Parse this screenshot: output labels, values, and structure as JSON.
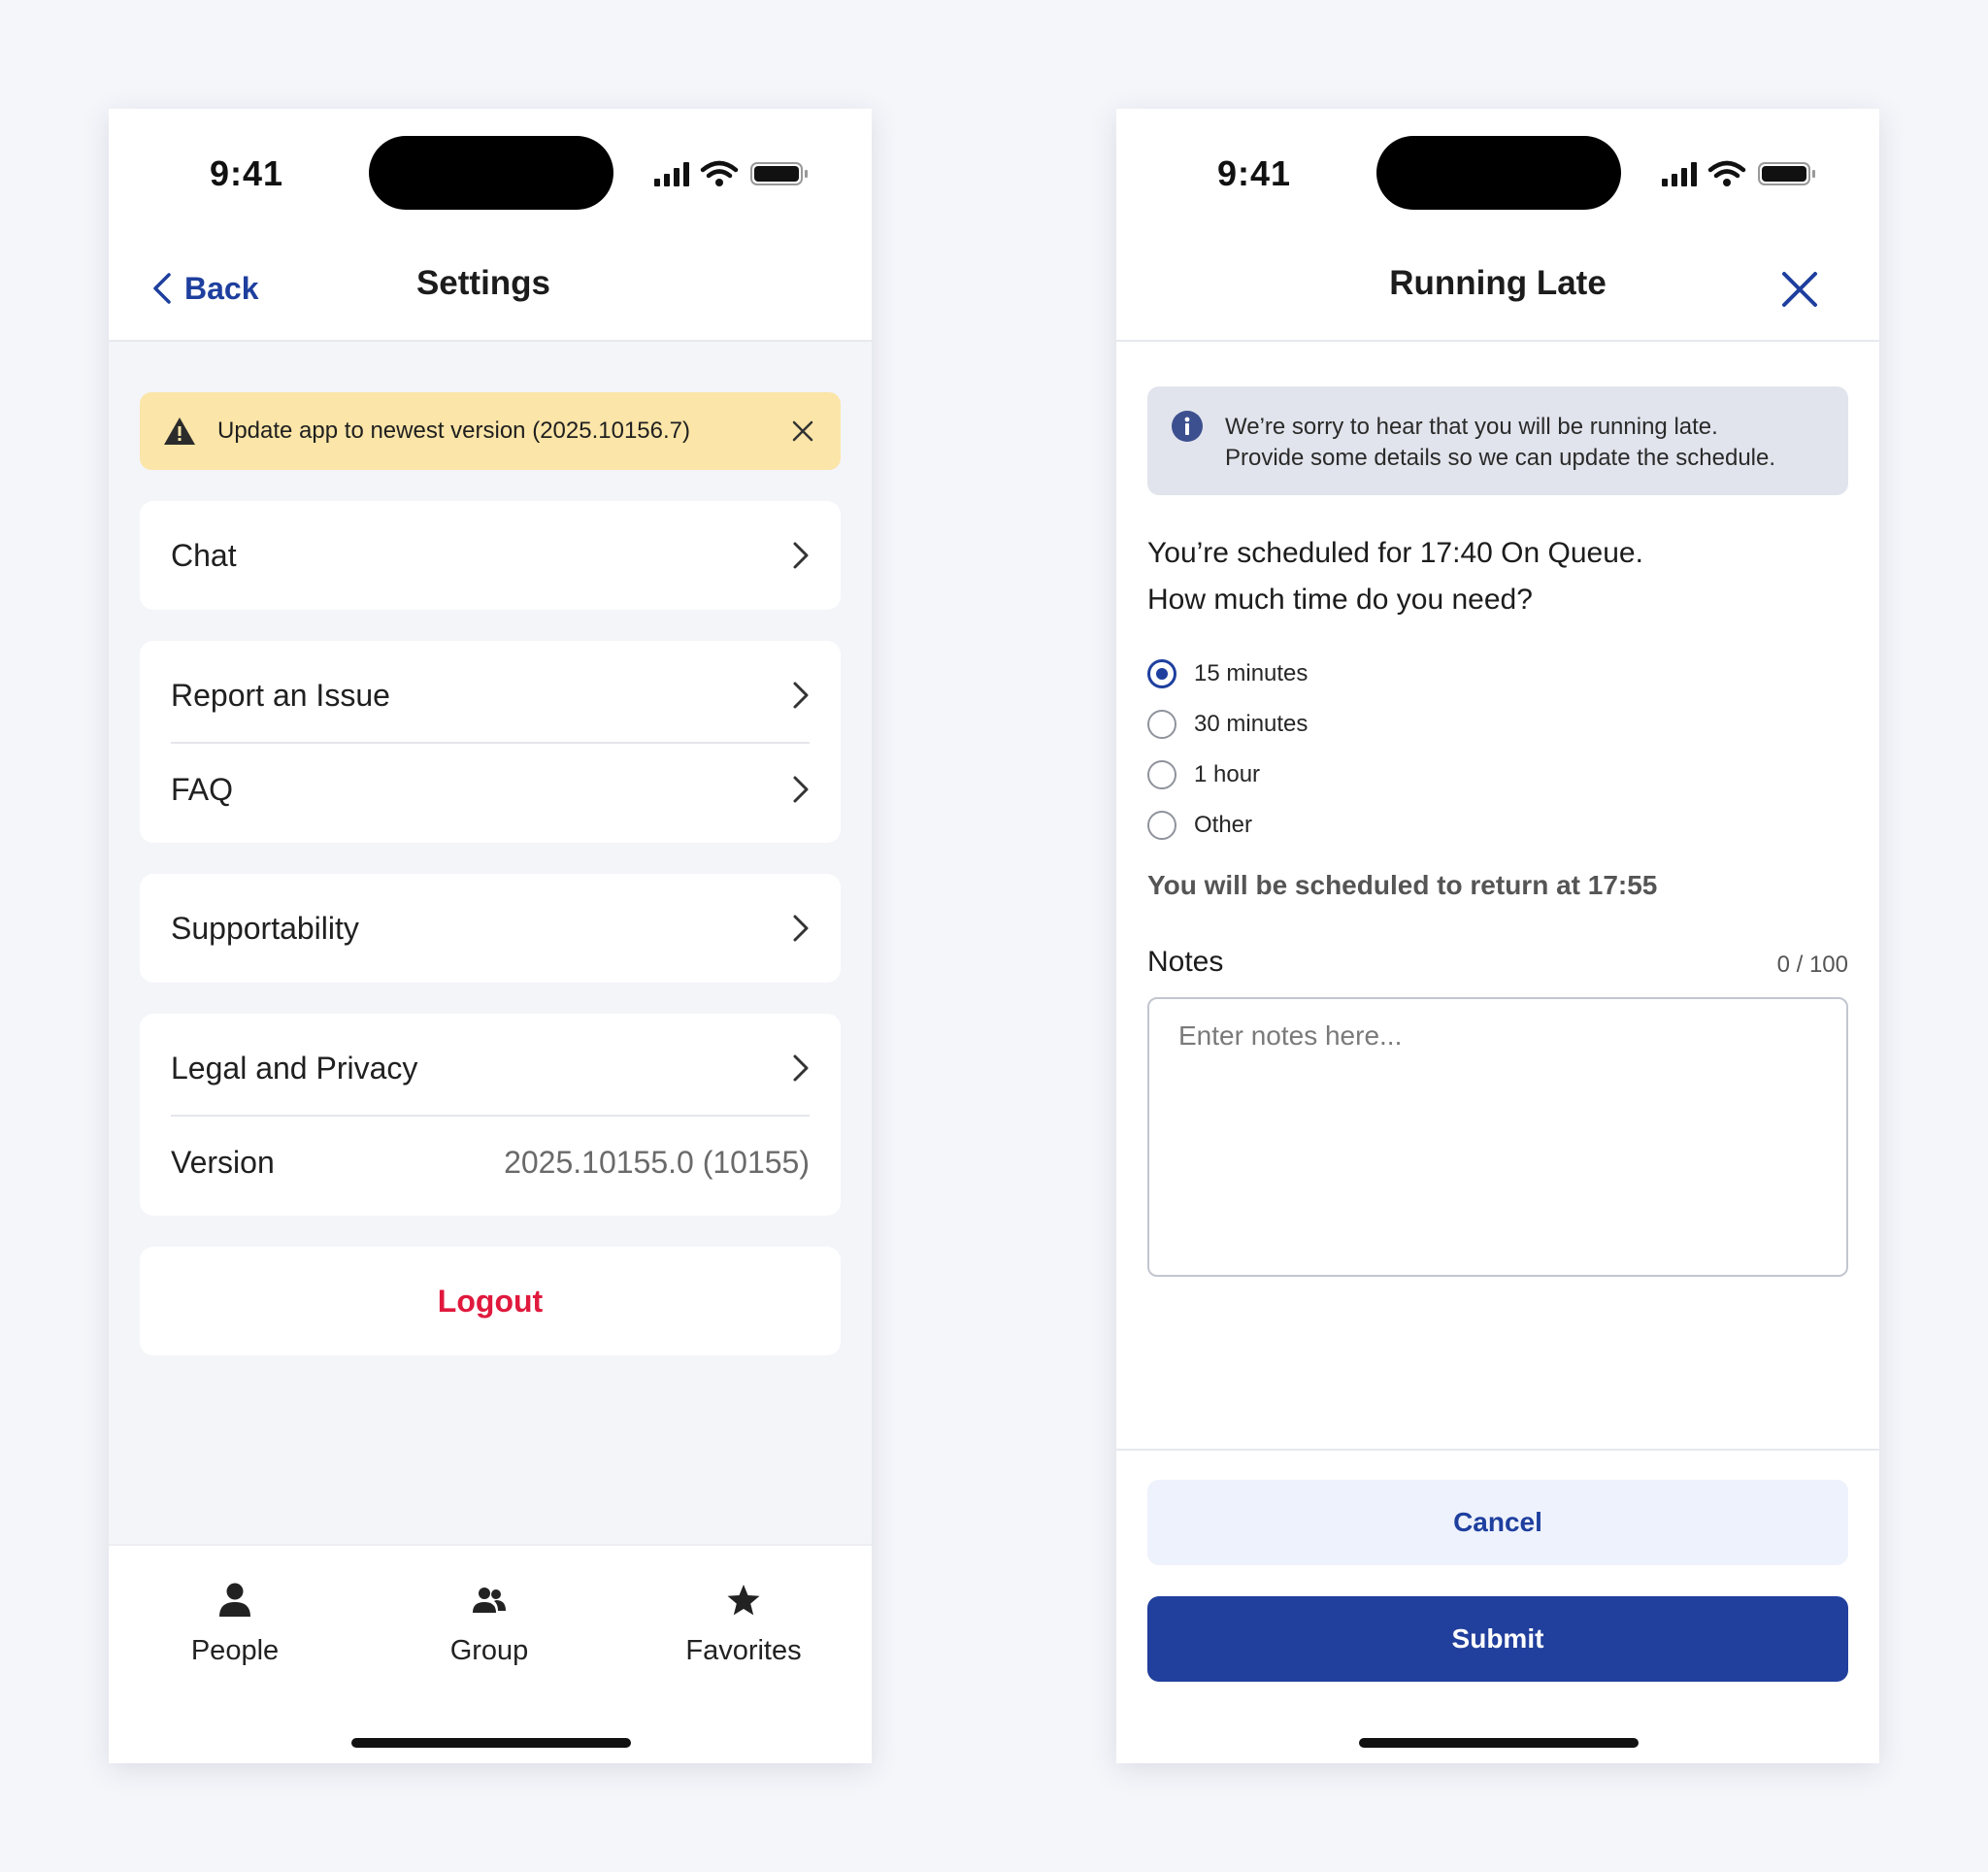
{
  "colors": {
    "accent": "#1e3f9e",
    "warning_bg": "#fbe5a8",
    "logout": "#e0193d",
    "submit_bg": "#213f9c"
  },
  "settings_screen": {
    "status_time": "9:41",
    "nav": {
      "back_label": "Back",
      "title": "Settings"
    },
    "banner": {
      "text": "Update app to newest version (2025.10156.7)",
      "icon": "warning-icon"
    },
    "menu_groups": [
      {
        "items": [
          {
            "label": "Chat"
          }
        ]
      },
      {
        "items": [
          {
            "label": "Report an Issue"
          },
          {
            "label": "FAQ"
          }
        ]
      },
      {
        "items": [
          {
            "label": "Supportability"
          }
        ]
      },
      {
        "items": [
          {
            "label": "Legal and Privacy"
          }
        ],
        "version": {
          "label": "Version",
          "value": "2025.10155.0 (10155)"
        }
      }
    ],
    "logout_label": "Logout",
    "tabs": [
      {
        "label": "People",
        "icon": "person-icon"
      },
      {
        "label": "Group",
        "icon": "group-icon"
      },
      {
        "label": "Favorites",
        "icon": "star-icon"
      }
    ]
  },
  "running_late_screen": {
    "status_time": "9:41",
    "nav": {
      "title": "Running Late"
    },
    "info": {
      "line1": "We’re sorry to hear that you will be running late.",
      "line2": "Provide some details so we can update the schedule."
    },
    "question": {
      "line1": "You’re scheduled for 17:40 On Queue.",
      "line2": "How much time do you need?"
    },
    "options": [
      {
        "label": "15 minutes",
        "selected": true
      },
      {
        "label": "30 minutes",
        "selected": false
      },
      {
        "label": "1 hour",
        "selected": false
      },
      {
        "label": "Other",
        "selected": false
      }
    ],
    "return_text": "You will be scheduled to return at 17:55",
    "notes": {
      "label": "Notes",
      "counter": "0 / 100",
      "placeholder": "Enter notes here...",
      "value": ""
    },
    "cancel_label": "Cancel",
    "submit_label": "Submit"
  }
}
